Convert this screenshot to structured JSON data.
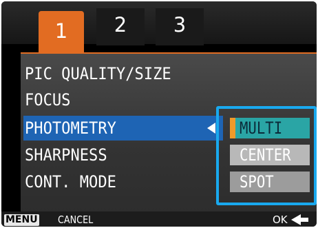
{
  "tabs": [
    {
      "label": "1",
      "active": true
    },
    {
      "label": "2",
      "active": false
    },
    {
      "label": "3",
      "active": false
    }
  ],
  "menu": {
    "items": [
      {
        "label": "PIC QUALITY/SIZE"
      },
      {
        "label": "FOCUS"
      },
      {
        "label": "PHOTOMETRY",
        "selected": true
      },
      {
        "label": "SHARPNESS"
      },
      {
        "label": "CONT. MODE"
      }
    ]
  },
  "options": {
    "items": [
      {
        "label": "MULTI",
        "selected": true
      },
      {
        "label": "CENTER"
      },
      {
        "label": "SPOT"
      }
    ]
  },
  "footer": {
    "menu_key": "MENU",
    "cancel_label": "CANCEL",
    "ok_label": "OK"
  },
  "colors": {
    "active_tab": "#e26c22",
    "selection_bar": "#1e64b4",
    "options_highlight": "#19a9ef",
    "selected_option": "#2aa5a5"
  }
}
